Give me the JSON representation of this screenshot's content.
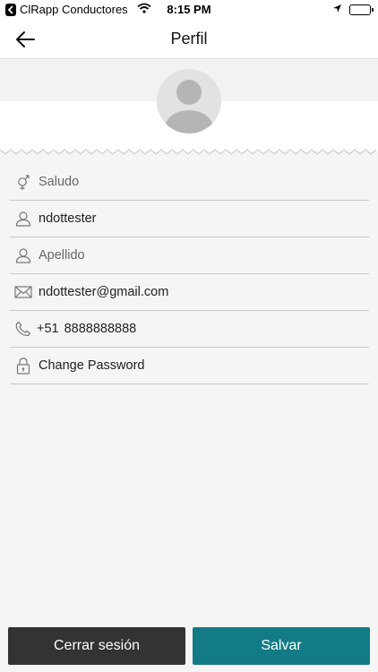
{
  "status_bar": {
    "app_name": "ClRapp Conductores",
    "time": "8:15 PM"
  },
  "nav": {
    "title": "Perfil"
  },
  "form": {
    "salutation_placeholder": "Saludo",
    "first_name": "ndottester",
    "last_name_placeholder": "Apellido",
    "email": "ndottester@gmail.com",
    "phone_prefix": "+51",
    "phone": "8888888888",
    "change_password": "Change Password"
  },
  "buttons": {
    "logout": "Cerrar sesión",
    "save": "Salvar"
  },
  "colors": {
    "save_button": "#137b85",
    "logout_button": "#333333"
  },
  "icons": {
    "back": "arrow-left-icon",
    "salutation": "gender-icon",
    "first_name": "user-icon",
    "last_name": "user-icon",
    "email": "envelope-icon",
    "phone": "phone-icon",
    "password": "lock-icon"
  }
}
